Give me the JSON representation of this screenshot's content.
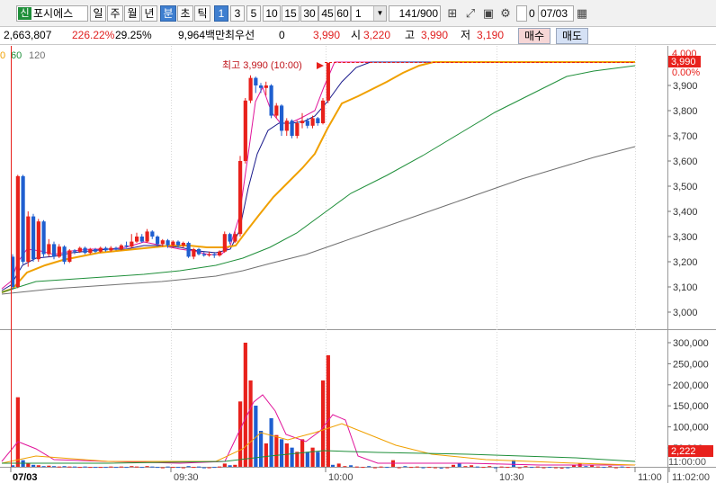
{
  "toolbar": {
    "stock_tag": "신",
    "stock_name": "포시에스",
    "period_tabs": [
      "일",
      "주",
      "월",
      "년",
      "분",
      "초",
      "틱"
    ],
    "active_period": "분",
    "interval_buttons": [
      "1",
      "3",
      "5",
      "10",
      "15",
      "30",
      "45",
      "60"
    ],
    "active_interval": "1",
    "interval_select": "1",
    "data_count": "141",
    "data_total": "/900",
    "checkbox_value": "0",
    "date": "07/03"
  },
  "quote": {
    "volume": "2,663,807",
    "volume_ratio": "226.22%",
    "change_rate": "29.25%",
    "amount": "9,964백만",
    "priority_label": "최우선",
    "priority_value": "0",
    "current_price": "3,990",
    "open_label": "시",
    "open_value": "3,220",
    "high_label": "고",
    "high_value": "3,990",
    "low_label": "저",
    "low_value": "3,190",
    "sell_button": "매수",
    "buy_button": "매도"
  },
  "legend": {
    "items": [
      "0",
      "60",
      "120"
    ]
  },
  "price_panel": {
    "high_annotation": "최고 3,990 (10:00)",
    "top_label": "4,000",
    "current_tag": "3,990",
    "pct_tag": "0.00%",
    "y_ticks": [
      "3,900",
      "3,800",
      "3,700",
      "3,600",
      "3,500",
      "3,400",
      "3,300",
      "3,200",
      "3,100",
      "3,000"
    ]
  },
  "volume_panel": {
    "y_ticks": [
      "300,000",
      "250,000",
      "200,000",
      "150,000",
      "100,000",
      "50,000"
    ],
    "current_tag": "2,222",
    "bottom_tag": "11:00:00"
  },
  "x_axis": {
    "labels": [
      "07/03",
      "09:30",
      "10:00",
      "10:30",
      "11:00",
      "11:02:00"
    ]
  },
  "colors": {
    "up": "#e8211c",
    "down": "#1f5fd0",
    "ma5": "#e0149a",
    "ma10": "#1a1a8c",
    "ma20": "#f0a000",
    "ma60": "#1f8f3a",
    "ma120": "#707070"
  }
}
